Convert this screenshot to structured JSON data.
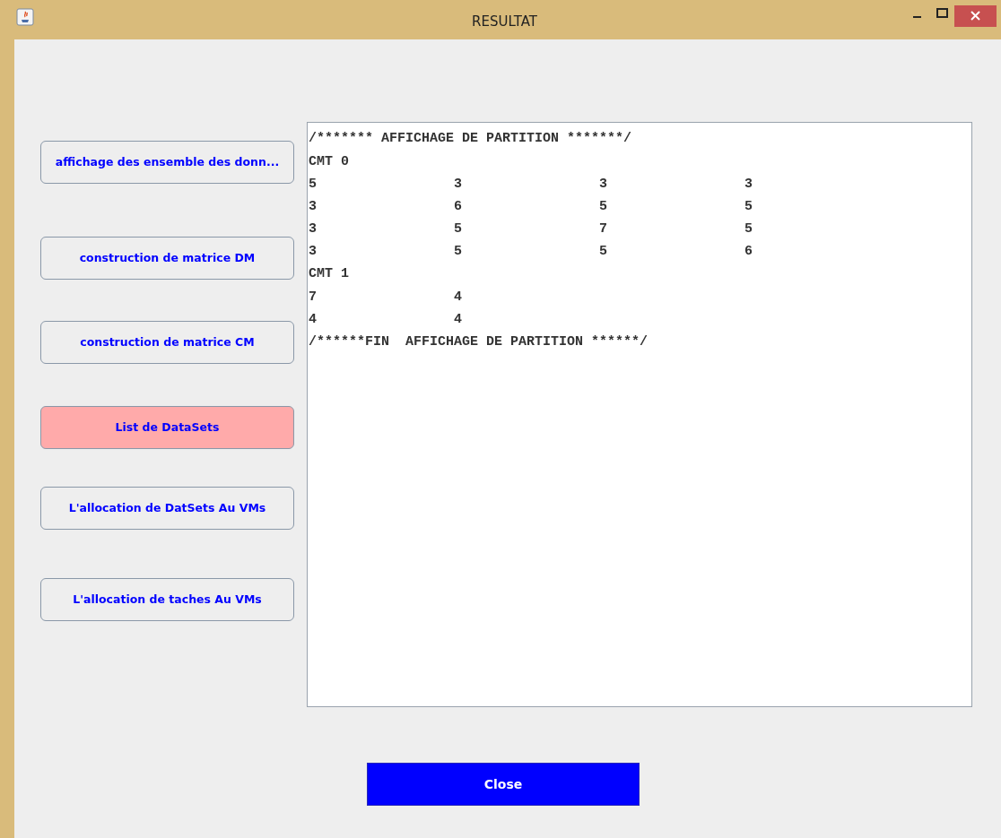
{
  "window": {
    "title": "RESULTAT"
  },
  "side_buttons": [
    {
      "label": "affichage des ensemble des donn...",
      "selected": false
    },
    {
      "label": "construction de matrice DM",
      "selected": false
    },
    {
      "label": "construction de matrice CM",
      "selected": false
    },
    {
      "label": "List de DataSets",
      "selected": true
    },
    {
      "label": "L'allocation de DatSets Au VMs",
      "selected": false
    },
    {
      "label": "L'allocation de taches Au VMs",
      "selected": false
    }
  ],
  "output_lines": [
    {
      "kind": "text",
      "text": "/******* AFFICHAGE DE PARTITION *******/"
    },
    {
      "kind": "text",
      "text": "CMT 0"
    },
    {
      "kind": "row",
      "cells": [
        "5",
        "3",
        "3",
        "3"
      ]
    },
    {
      "kind": "row",
      "cells": [
        "3",
        "6",
        "5",
        "5"
      ]
    },
    {
      "kind": "row",
      "cells": [
        "3",
        "5",
        "7",
        "5"
      ]
    },
    {
      "kind": "row",
      "cells": [
        "3",
        "5",
        "5",
        "6"
      ]
    },
    {
      "kind": "text",
      "text": "CMT 1"
    },
    {
      "kind": "row",
      "cells": [
        "7",
        "4"
      ]
    },
    {
      "kind": "row",
      "cells": [
        "4",
        "4"
      ]
    },
    {
      "kind": "text",
      "text": "/******FIN  AFFICHAGE DE PARTITION ******/"
    }
  ],
  "close_button": {
    "label": "Close"
  }
}
